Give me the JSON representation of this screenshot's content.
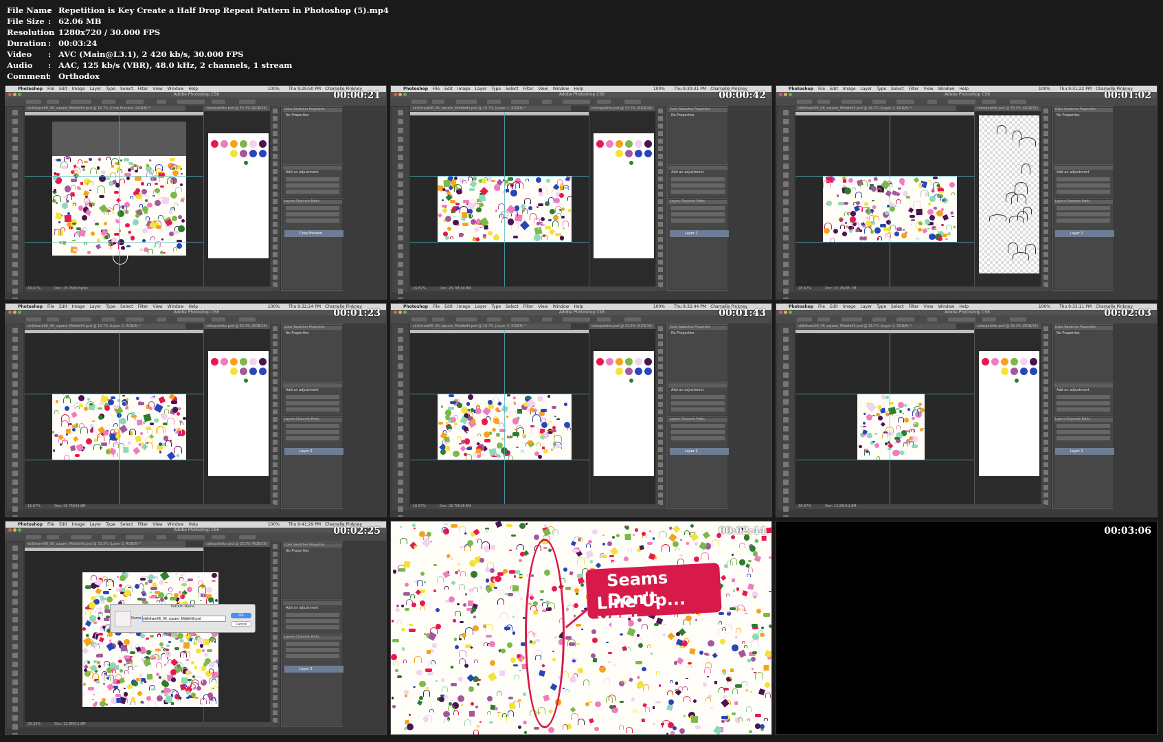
{
  "info": [
    {
      "key": "File Name",
      "value": "Repetition is Key Create a Half Drop Repeat Pattern in Photoshop (5).mp4"
    },
    {
      "key": "File Size",
      "value": "62.06 MB"
    },
    {
      "key": "Resolution",
      "value": "1280x720 / 30.000 FPS"
    },
    {
      "key": "Duration",
      "value": "00:03:24"
    },
    {
      "key": "Video",
      "value": "AVC (Main@L3.1), 2 420 kb/s, 30.000 FPS"
    },
    {
      "key": "Audio",
      "value": "AAC, 125 kb/s (VBR), 48.0 kHz, 2 channels, 1 stream"
    },
    {
      "key": "Comment",
      "value": "Orthodox"
    }
  ],
  "separator": ":",
  "thumbnails": [
    {
      "timestamp": "00:00:21",
      "type": "photoshop",
      "doc_title": "skillshare06_06_square_Middlefill.psd @ 16.7% (Crop Preview, RGB/8) *",
      "clock": "Thu 9:29:50 PM",
      "status": "Doc: 25.7M/0 bytes",
      "layer": "Crop Preview"
    },
    {
      "timestamp": "00:00:42",
      "type": "photoshop",
      "doc_title": "skillshare06_06_square_Middlefill.psd @ 16.7% (Layer 1, RGB/8) *",
      "clock": "Thu 9:30:31 PM",
      "status": "Doc: 25.7M/34.8M",
      "layer": "Layer 1"
    },
    {
      "timestamp": "00:01:02",
      "type": "photoshop",
      "doc_title": "skillshare06_06_square_Middlefill.psd @ 16.7% (Layer 2, RGB/8) *",
      "clock": "Thu 9:31:22 PM",
      "status": "Doc: 25.7M/35.7M",
      "layer": "Layer 2"
    },
    {
      "timestamp": "00:01:23",
      "type": "photoshop",
      "doc_title": "skillshare06_06_square_Middlefill.psd @ 16.7% (Layer 2, RGB/8) *",
      "clock": "Thu 9:32:24 PM",
      "status": "Doc: 25.7M/34.8M",
      "layer": "Layer 2"
    },
    {
      "timestamp": "00:01:43",
      "type": "photoshop",
      "doc_title": "skillshare06_06_square_Middlefill.psd @ 16.7% (Layer 2, RGB/8) *",
      "clock": "Thu 9:32:44 PM",
      "status": "Doc: 25.7M/26.5M",
      "layer": "Layer 2"
    },
    {
      "timestamp": "00:02:03",
      "type": "photoshop",
      "doc_title": "skillshare06_06_square_Middlefill.psd @ 16.7% (Layer 2, RGB/8) *",
      "clock": "Thu 9:33:11 PM",
      "status": "Doc: 12.8M/12.8M",
      "layer": "Layer 2"
    },
    {
      "timestamp": "00:02:25",
      "type": "photoshop-dialog",
      "doc_title": "skillshare06_06_square_Middlefill.psd @ 33.3% (Layer 2, RGB/8) *",
      "clock": "Thu 9:41:29 PM",
      "status": "Doc: 12.8M/12.8M",
      "layer": "Layer 2",
      "dialog": {
        "title": "Pattern Name",
        "name_label": "Name:",
        "name_value": "skillshare06_06_square_Middlefill.psd",
        "ok": "OK",
        "cancel": "Cancel"
      }
    },
    {
      "timestamp": "00:02:44",
      "type": "pattern-banner",
      "banner_line1": "Seams Don't",
      "banner_line2": "Line Up... YET!"
    },
    {
      "timestamp": "00:03:06",
      "type": "blank"
    }
  ],
  "ps": {
    "app": "Photoshop",
    "menus": [
      "File",
      "Edit",
      "Image",
      "Layer",
      "Type",
      "Select",
      "Filter",
      "View",
      "Window",
      "Help"
    ],
    "window_title": "Adobe Photoshop CS6",
    "user": "Charnelle Pinkney",
    "zoom": "100%",
    "second_doc": "colorpalette.psd @ 33.3% (RGB/16)",
    "panel_tabs": [
      "Color",
      "Swatches",
      "Properties"
    ],
    "no_properties": "No Properties",
    "adjustments": "Add an adjustment",
    "layers_tabs": [
      "Layers",
      "Channels",
      "Paths"
    ],
    "zoom_status": "16.67%",
    "zoom_status2": "33.33%"
  },
  "colors": {
    "palette": [
      "#e8194f",
      "#f07cc0",
      "#f5a31f",
      "#7cb84a",
      "#f3d3ef",
      "#4a1450",
      "#f4e23a",
      "#8fd8b8",
      "#a4579f",
      "#2846b8",
      "#2e7d2e"
    ]
  }
}
